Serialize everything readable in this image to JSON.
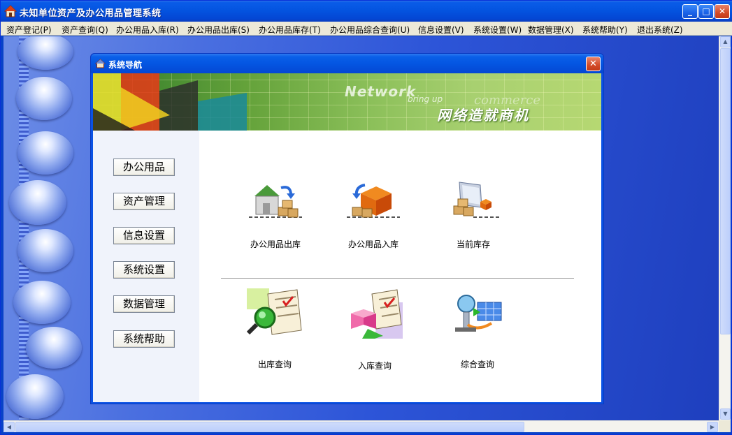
{
  "window": {
    "title": "未知单位资产及办公用品管理系统",
    "minimize": "_",
    "maximize": "□",
    "close": "✕"
  },
  "menu": [
    "资产登记(P)",
    "资产查询(Q)",
    "办公用品入库(R)",
    "办公用品出库(S)",
    "办公用品库存(T)",
    "办公用品综合查询(U)",
    "信息设置(V)",
    "系统设置(W)",
    "数据管理(X)",
    "系统帮助(Y)",
    "退出系统(Z)"
  ],
  "dialog": {
    "title": "系统导航",
    "close": "✕",
    "banner": {
      "network": "Network",
      "bring_up": "bring up",
      "commerce": "commerce",
      "slogan": "网络造就商机"
    },
    "nav_buttons": [
      "办公用品",
      "资产管理",
      "信息设置",
      "系统设置",
      "数据管理",
      "系统帮助"
    ],
    "tiles_top": [
      {
        "label": "办公用品出库",
        "icon": "warehouse-out-icon"
      },
      {
        "label": "办公用品入库",
        "icon": "warehouse-in-icon"
      },
      {
        "label": "当前库存",
        "icon": "current-stock-icon"
      }
    ],
    "tiles_bottom": [
      {
        "label": "出库查询",
        "icon": "outbound-query-icon"
      },
      {
        "label": "入库查询",
        "icon": "inbound-query-icon"
      },
      {
        "label": "综合查询",
        "icon": "combined-query-icon"
      }
    ]
  },
  "colors": {
    "title_blue": "#0454e0",
    "menubar": "#ece9d8",
    "close_red": "#d34b28"
  }
}
